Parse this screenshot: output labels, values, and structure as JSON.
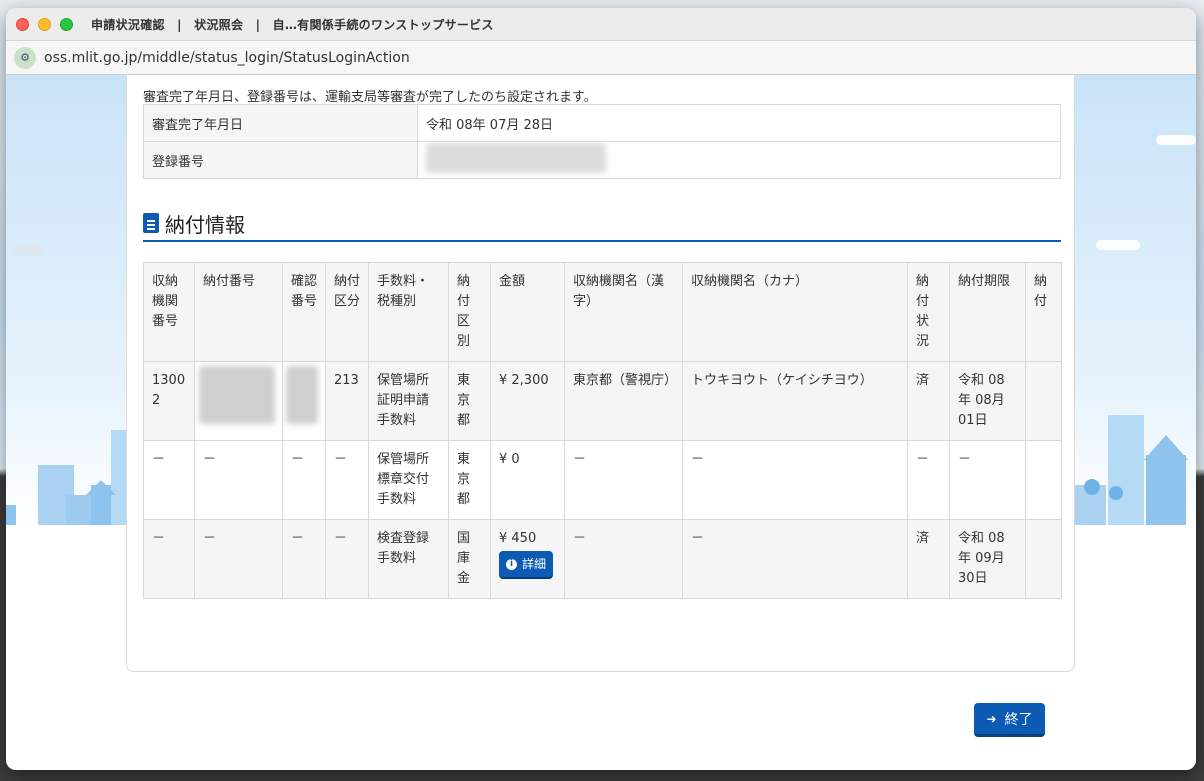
{
  "window": {
    "title": "申請状況確認　|　状況照会　|　自…有関係手続のワンストップサービス",
    "url": "oss.mlit.go.jp/middle/status_login/StatusLoginAction"
  },
  "review": {
    "note": "審査完了年月日、登録番号は、運輸支局等審査が完了したのち設定されます。",
    "rows": [
      {
        "label": "審査完了年月日",
        "value": "令和 08年 07月 28日"
      },
      {
        "label": "登録番号",
        "value": ""
      }
    ]
  },
  "payment": {
    "section_title": "納付情報",
    "headers": [
      "収納機関番号",
      "納付番号",
      "確認番号",
      "納付区分",
      "手数料・税種別",
      "納付区別",
      "金額",
      "収納機関名（漢字）",
      "収納機関名（カナ）",
      "納付状況",
      "納付期限",
      "納付"
    ],
    "rows": [
      {
        "agency_no": "13002",
        "pay_no": "",
        "confirm_no": "",
        "pay_class": "213",
        "fee_type": "保管場所証明申請手数料",
        "pay_kind": "東京都",
        "amount": "¥ 2,300",
        "agency_kanji": "東京都（警視庁）",
        "agency_kana": "トウキヨウト（ケイシチヨウ）",
        "status": "済",
        "deadline": "令和 08年 08月 01日",
        "pay": ""
      },
      {
        "agency_no": "－",
        "pay_no": "－",
        "confirm_no": "－",
        "pay_class": "－",
        "fee_type": "保管場所標章交付手数料",
        "pay_kind": "東京都",
        "amount": "¥ 0",
        "agency_kanji": "－",
        "agency_kana": "－",
        "status": "－",
        "deadline": "－",
        "pay": ""
      },
      {
        "agency_no": "－",
        "pay_no": "－",
        "confirm_no": "－",
        "pay_class": "－",
        "fee_type": "検査登録手数料",
        "pay_kind": "国庫金",
        "amount": "¥ 450",
        "agency_kanji": "－",
        "agency_kana": "－",
        "status": "済",
        "deadline": "令和 08年 09月 30日",
        "pay": ""
      }
    ],
    "detail_button": "詳細"
  },
  "footer": {
    "end_button": "終了"
  },
  "colors": {
    "accent": "#0b5bb4",
    "header_bg": "#f5f5f5",
    "border": "#d8d8d8"
  }
}
